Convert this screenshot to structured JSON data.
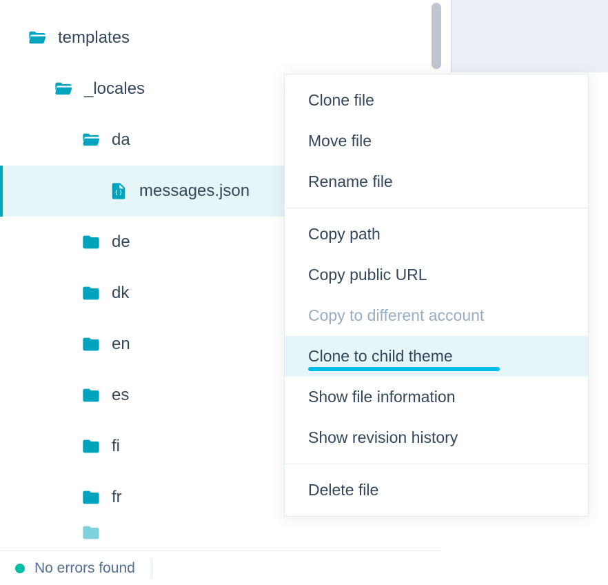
{
  "tree": {
    "root": {
      "label": "templates"
    },
    "child": {
      "label": "_locales"
    },
    "items": [
      {
        "label": "da",
        "type": "folder-open"
      },
      {
        "label": "messages.json",
        "type": "file",
        "selected": true
      },
      {
        "label": "de",
        "type": "folder"
      },
      {
        "label": "dk",
        "type": "folder"
      },
      {
        "label": "en",
        "type": "folder"
      },
      {
        "label": "es",
        "type": "folder"
      },
      {
        "label": "fi",
        "type": "folder"
      },
      {
        "label": "fr",
        "type": "folder"
      }
    ]
  },
  "context_menu": {
    "groups": [
      [
        {
          "label": "Clone file"
        },
        {
          "label": "Move file"
        },
        {
          "label": "Rename file"
        }
      ],
      [
        {
          "label": "Copy path"
        },
        {
          "label": "Copy public URL"
        },
        {
          "label": "Copy to different account",
          "disabled": true
        },
        {
          "label": "Clone to child theme",
          "highlighted": true,
          "underline": true
        },
        {
          "label": "Show file information"
        },
        {
          "label": "Show revision history"
        }
      ],
      [
        {
          "label": "Delete file"
        }
      ]
    ]
  },
  "status": {
    "text": "No errors found"
  }
}
